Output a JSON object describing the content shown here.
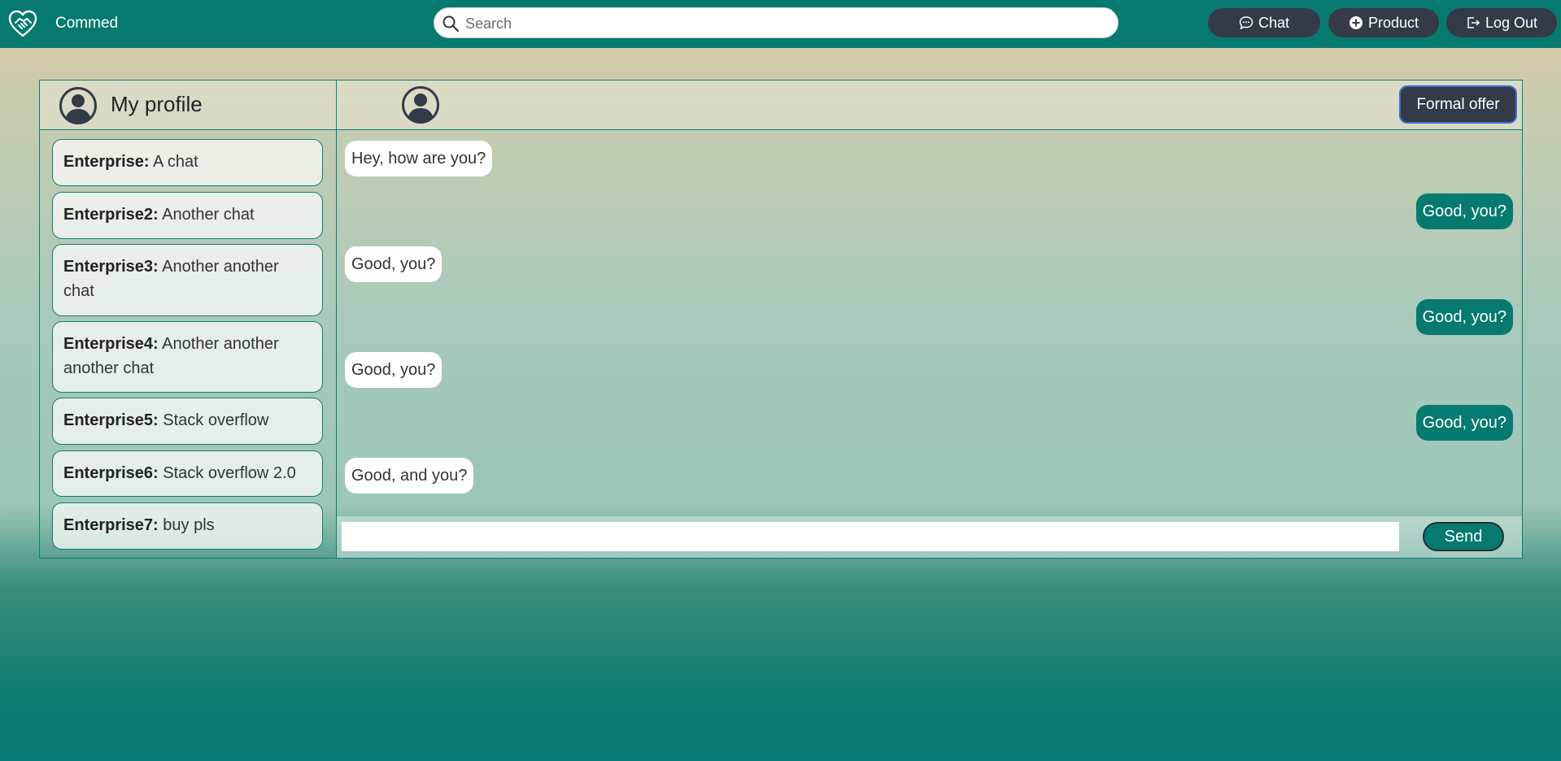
{
  "app": {
    "name": "Commed",
    "brand_icon": "handshake-heart-icon"
  },
  "search": {
    "placeholder": "Search",
    "value": ""
  },
  "nav": {
    "chat_label": "Chat",
    "chat_icon": "chat-bubble-icon",
    "product_label": "Product",
    "product_icon": "plus-circle-icon",
    "logout_label": "Log Out",
    "logout_icon": "logout-icon"
  },
  "sidebar": {
    "title": "My profile",
    "chats": [
      {
        "enterprise": "Enterprise:",
        "text": "A chat"
      },
      {
        "enterprise": "Enterprise2:",
        "text": "Another chat"
      },
      {
        "enterprise": "Enterprise3:",
        "text": "Another another chat"
      },
      {
        "enterprise": "Enterprise4:",
        "text": "Another another another chat"
      },
      {
        "enterprise": "Enterprise5:",
        "text": "Stack overflow"
      },
      {
        "enterprise": "Enterprise6:",
        "text": "Stack overflow 2.0"
      },
      {
        "enterprise": "Enterprise7:",
        "text": "buy pls"
      }
    ]
  },
  "conversation": {
    "formal_offer_label": "Formal offer",
    "messages": [
      {
        "direction": "in",
        "text": "Hey, how are you?"
      },
      {
        "direction": "out",
        "text": "Good, you?"
      },
      {
        "direction": "in",
        "text": "Good, you?"
      },
      {
        "direction": "out",
        "text": "Good, you?"
      },
      {
        "direction": "in",
        "text": "Good, you?"
      },
      {
        "direction": "out",
        "text": "Good, you?"
      },
      {
        "direction": "in",
        "text": "Good, and you?"
      }
    ],
    "composer_value": "",
    "send_label": "Send"
  },
  "colors": {
    "primary": "#067a6f",
    "dark_button": "#343a48",
    "border": "#0d8073"
  }
}
